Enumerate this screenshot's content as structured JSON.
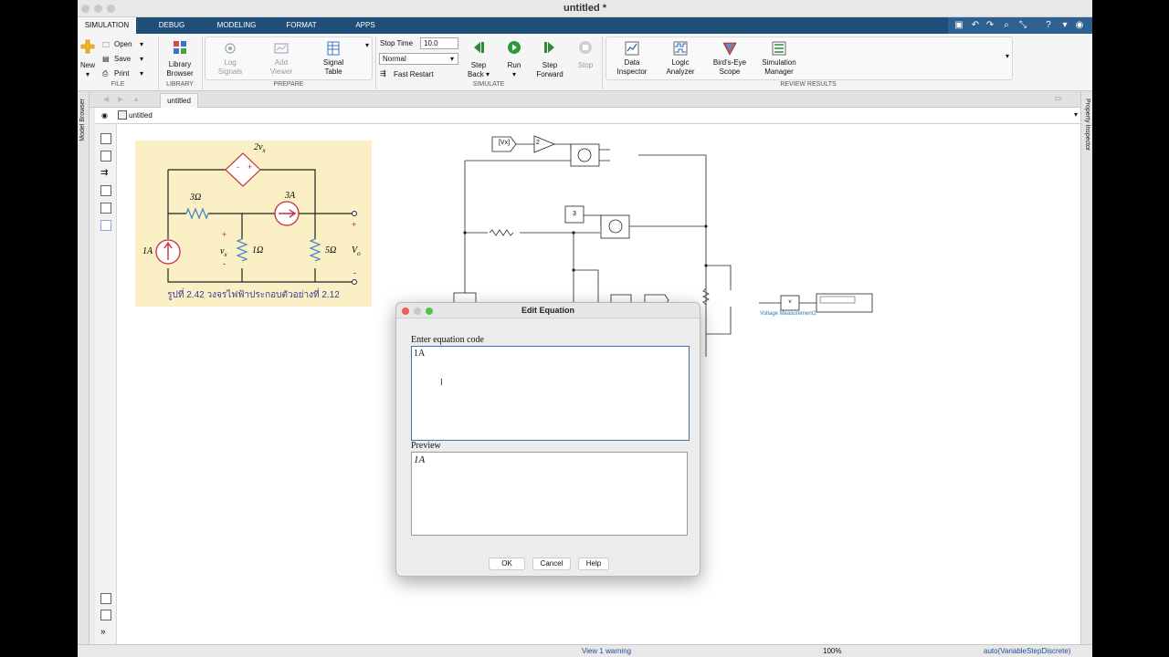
{
  "window": {
    "title": "untitled *"
  },
  "tabs": [
    {
      "label": "SIMULATION",
      "active": true
    },
    {
      "label": "DEBUG",
      "active": false
    },
    {
      "label": "MODELING",
      "active": false
    },
    {
      "label": "FORMAT",
      "active": false
    },
    {
      "label": "APPS",
      "active": false
    }
  ],
  "ribbon": {
    "file": {
      "new": "New",
      "open": "Open",
      "save": "Save",
      "print": "Print",
      "section": "FILE"
    },
    "library": {
      "label_1": "Library",
      "label_2": "Browser",
      "section": "LIBRARY"
    },
    "prepare": {
      "log_1": "Log",
      "log_2": "Signals",
      "add_1": "Add",
      "add_2": "Viewer",
      "signal_1": "Signal",
      "signal_2": "Table",
      "section": "PREPARE"
    },
    "simulate": {
      "stop_time_label": "Stop Time",
      "stop_time_value": "10.0",
      "mode_value": "Normal",
      "fast_restart": "Fast Restart",
      "step_back_1": "Step",
      "step_back_2": "Back",
      "run": "Run",
      "step_forward_1": "Step",
      "step_forward_2": "Forward",
      "stop": "Stop",
      "section": "SIMULATE"
    },
    "review": {
      "data_1": "Data",
      "data_2": "Inspector",
      "logic_1": "Logic",
      "logic_2": "Analyzer",
      "birds_1": "Bird's-Eye",
      "birds_2": "Scope",
      "simman_1": "Simulation",
      "simman_2": "Manager",
      "section": "REVIEW RESULTS"
    }
  },
  "doc_tab": "untitled",
  "address": "untitled",
  "side_panels": {
    "left": "Model Browser",
    "right": "Property Inspector"
  },
  "figure": {
    "dep_source": "2v",
    "dep_source_sub": "x",
    "r1": "3Ω",
    "cs2": "3A",
    "cs1": "1A",
    "vx": "v",
    "vx_sub": "x",
    "r2": "1Ω",
    "r3": "5Ω",
    "vo": "V",
    "vo_sub": "o",
    "plus": "+",
    "minus": "-",
    "caption": "รูปที่ 2.42 วงจรไฟฟ้าประกอบตัวอย่างที่ 2.12"
  },
  "model": {
    "goto_tag": "[Vx]",
    "gain": "2",
    "constant": "3",
    "voltage_measurement": "Voltage Measurement1",
    "meas_v": "v"
  },
  "dialog": {
    "title": "Edit Equation",
    "code_label": "Enter equation code",
    "code_value": "1A",
    "preview_label": "Preview",
    "preview_value": "1A",
    "ok": "OK",
    "cancel": "Cancel",
    "help": "Help"
  },
  "status": {
    "warning": "View 1 warning",
    "zoom": "100%",
    "solver": "auto(VariableStepDiscrete)"
  }
}
